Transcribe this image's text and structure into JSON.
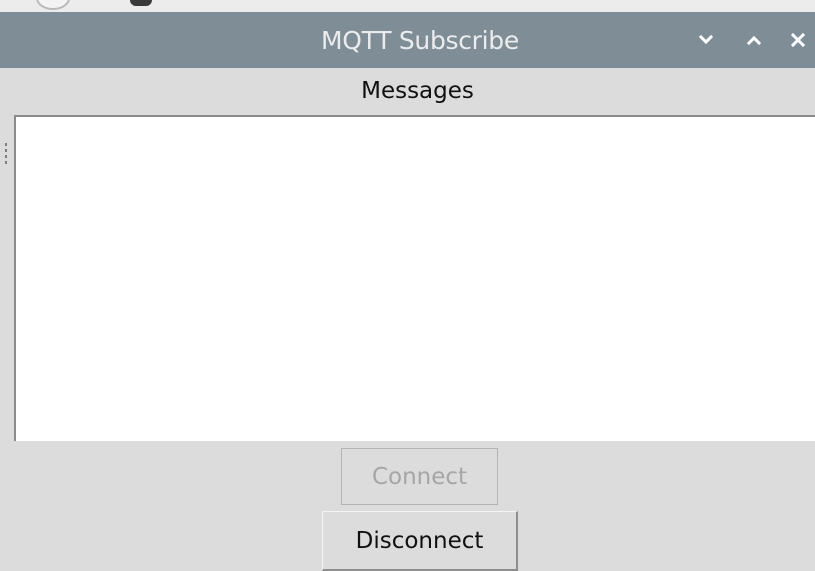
{
  "window": {
    "title": "MQTT Subscribe",
    "titlebar_color": "#7f8d97",
    "controls": {
      "minimize_icon": "chevron-down-icon",
      "maximize_icon": "chevron-up-icon",
      "close_icon": "close-icon"
    }
  },
  "messages": {
    "label": "Messages",
    "content": ""
  },
  "buttons": {
    "connect_label": "Connect",
    "connect_enabled": false,
    "disconnect_label": "Disconnect"
  }
}
